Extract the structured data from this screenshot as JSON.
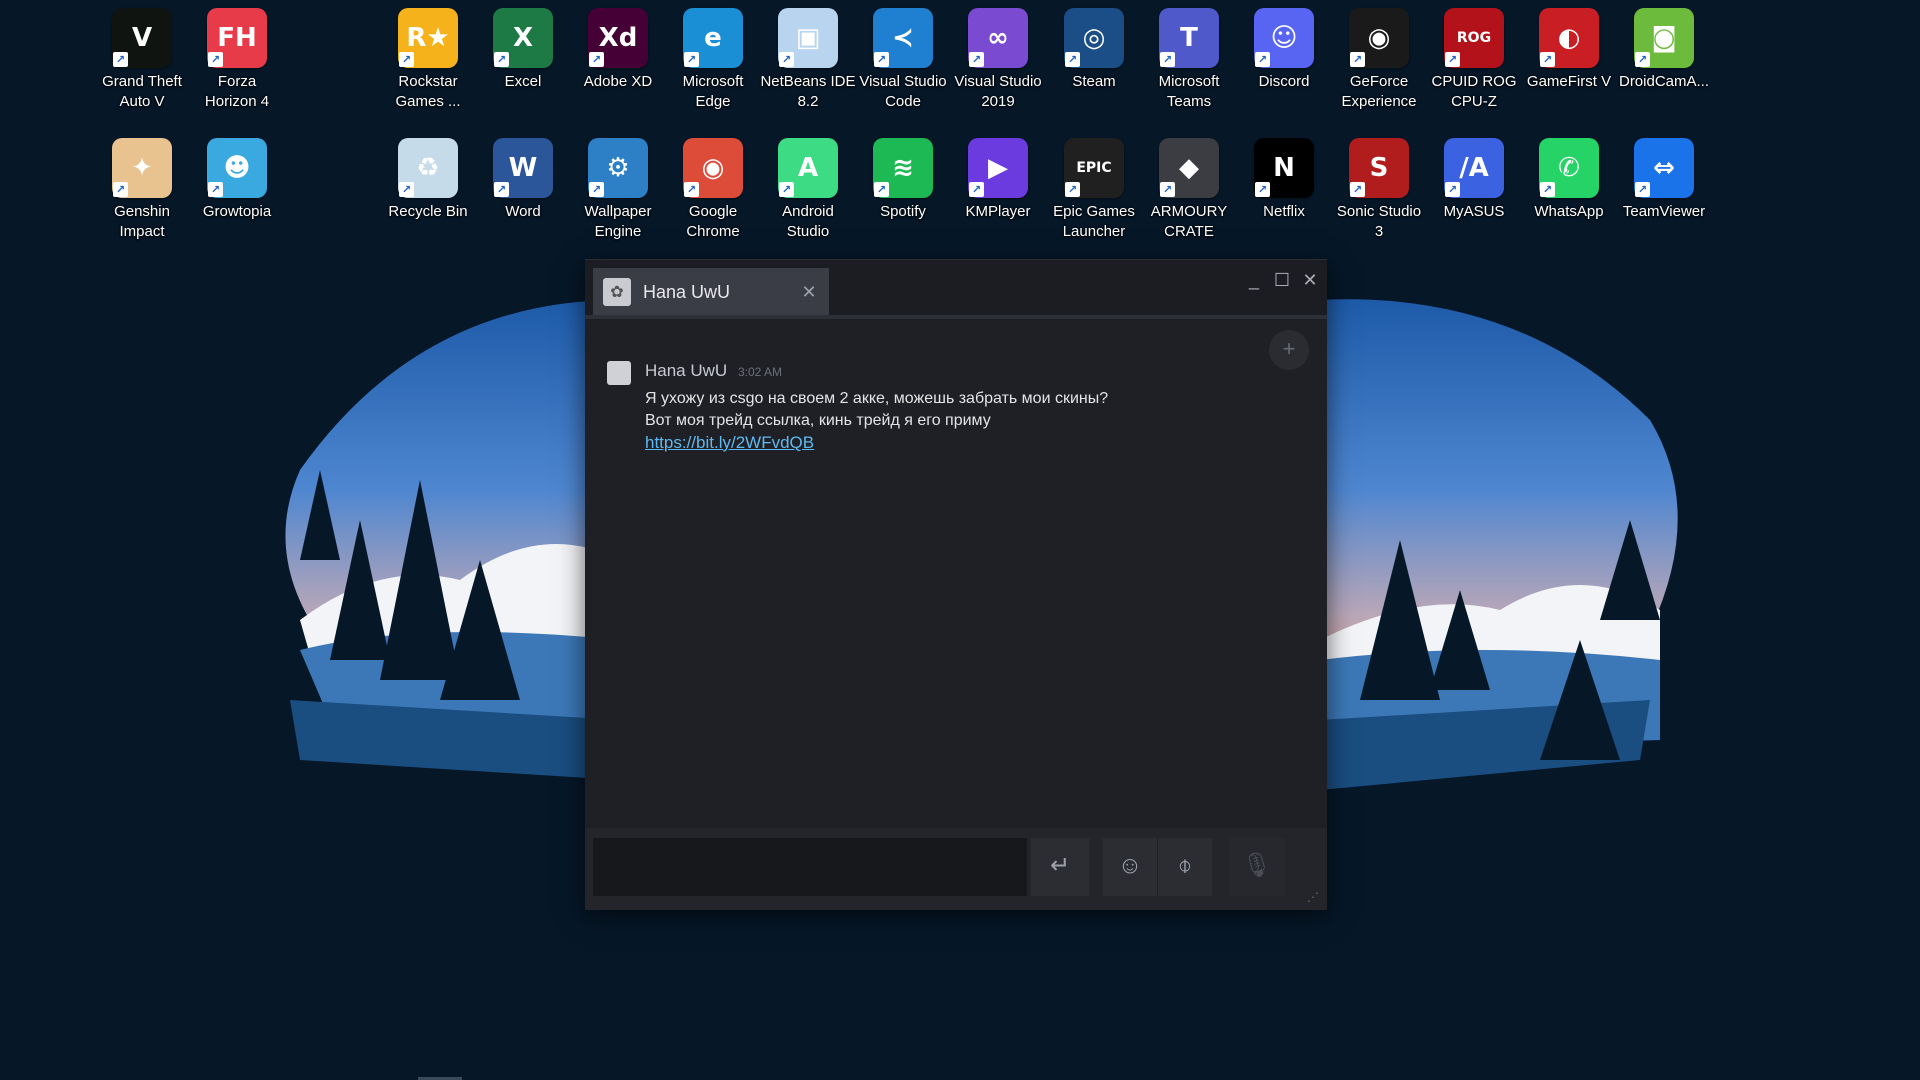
{
  "desktop": {
    "row1": [
      {
        "label": "Grand Theft\nAuto V",
        "icon": "gta-v-icon",
        "color": "#0f1410",
        "glyph": "V"
      },
      {
        "label": "Forza\nHorizon 4",
        "icon": "forza-horizon-4-icon",
        "color": "#e83b4a",
        "glyph": "FH"
      },
      {
        "label": "Rockstar\nGames ...",
        "icon": "rockstar-games-icon",
        "color": "#f5b21a",
        "glyph": "R★"
      },
      {
        "label": "Excel",
        "icon": "excel-icon",
        "color": "#1d7a45",
        "glyph": "X"
      },
      {
        "label": "Adobe XD",
        "icon": "adobe-xd-icon",
        "color": "#450135",
        "glyph": "Xd"
      },
      {
        "label": "Microsoft\nEdge",
        "icon": "edge-icon",
        "color": "#1a8fd6",
        "glyph": "e"
      },
      {
        "label": "NetBeans IDE\n8.2",
        "icon": "netbeans-icon",
        "color": "#b8d4ee",
        "glyph": "▣"
      },
      {
        "label": "Visual Studio\nCode",
        "icon": "vscode-icon",
        "color": "#1f7fd0",
        "glyph": "≺"
      },
      {
        "label": "Visual Studio\n2019",
        "icon": "visual-studio-icon",
        "color": "#7a4bd1",
        "glyph": "∞"
      },
      {
        "label": "Steam",
        "icon": "steam-icon",
        "color": "#1b4e86",
        "glyph": "◎"
      },
      {
        "label": "Microsoft\nTeams",
        "icon": "teams-icon",
        "color": "#5059c9",
        "glyph": "T"
      },
      {
        "label": "Discord",
        "icon": "discord-icon",
        "color": "#5865f2",
        "glyph": "☺"
      },
      {
        "label": "GeForce\nExperience",
        "icon": "geforce-icon",
        "color": "#1a1a1a",
        "glyph": "◉"
      },
      {
        "label": "CPUID ROG\nCPU-Z",
        "icon": "cpu-z-icon",
        "color": "#b3121b",
        "glyph": "ROG"
      },
      {
        "label": "GameFirst V",
        "icon": "gamefirst-icon",
        "color": "#c81e24",
        "glyph": "◐"
      },
      {
        "label": "DroidCamA...",
        "icon": "droidcam-icon",
        "color": "#6dbb3c",
        "glyph": "◙"
      }
    ],
    "row2": [
      {
        "label": "Genshin\nImpact",
        "icon": "genshin-impact-icon",
        "color": "#e8c28f",
        "glyph": "✦"
      },
      {
        "label": "Growtopia",
        "icon": "growtopia-icon",
        "color": "#39a9e0",
        "glyph": "☻"
      },
      {
        "label": "Recycle Bin",
        "icon": "recycle-bin-icon",
        "color": "#c6dbe9",
        "glyph": "♻"
      },
      {
        "label": "Word",
        "icon": "word-icon",
        "color": "#2b579a",
        "glyph": "W"
      },
      {
        "label": "Wallpaper\nEngine",
        "icon": "wallpaper-engine-icon",
        "color": "#2d7fc6",
        "glyph": "⚙"
      },
      {
        "label": "Google\nChrome",
        "icon": "chrome-icon",
        "color": "#dd4b39",
        "glyph": "◉"
      },
      {
        "label": "Android\nStudio",
        "icon": "android-studio-icon",
        "color": "#3ddc84",
        "glyph": "A"
      },
      {
        "label": "Spotify",
        "icon": "spotify-icon",
        "color": "#1db954",
        "glyph": "≋"
      },
      {
        "label": "KMPlayer",
        "icon": "kmplayer-icon",
        "color": "#6b3be0",
        "glyph": "▶"
      },
      {
        "label": "Epic Games\nLauncher",
        "icon": "epic-games-icon",
        "color": "#202020",
        "glyph": "EPIC"
      },
      {
        "label": "ARMOURY\nCRATE",
        "icon": "armoury-crate-icon",
        "color": "#3b3d42",
        "glyph": "◆"
      },
      {
        "label": "Netflix",
        "icon": "netflix-icon",
        "color": "#000000",
        "glyph": "N"
      },
      {
        "label": "Sonic Studio\n3",
        "icon": "sonic-studio-icon",
        "color": "#b11c1c",
        "glyph": "S"
      },
      {
        "label": "MyASUS",
        "icon": "myasus-icon",
        "color": "#3b62e0",
        "glyph": "/A"
      },
      {
        "label": "WhatsApp",
        "icon": "whatsapp-icon",
        "color": "#25d366",
        "glyph": "✆"
      },
      {
        "label": "TeamViewer",
        "icon": "teamviewer-icon",
        "color": "#1a73e8",
        "glyph": "⇔"
      }
    ]
  },
  "chat": {
    "tab_name": "Hana UwU",
    "tab_close": "✕",
    "minimize": "_",
    "maximize": "☐",
    "close": "✕",
    "add_friend": "+",
    "message": {
      "sender": "Hana UwU",
      "time": "3:02 AM",
      "line1": "Я ухожу из csgo на своем 2 акке, можешь забрать мои скины?",
      "line2": "Вот моя трейд ссылка, кинь трейд я его приму",
      "link": "https://bit.ly/2WFvdQB"
    },
    "input_placeholder": "",
    "send_icon": "↵",
    "emoji_icon": "☺",
    "attach_icon": "⌽",
    "voice_icon": "🎙"
  }
}
